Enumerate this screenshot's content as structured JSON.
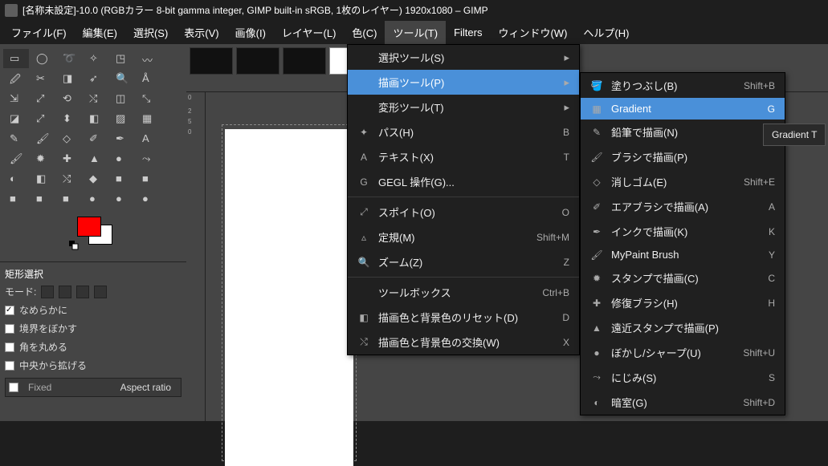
{
  "titlebar": {
    "text": "[名称未設定]-10.0 (RGBカラー 8-bit gamma integer, GIMP built-in sRGB, 1枚のレイヤー) 1920x1080 – GIMP"
  },
  "menubar": {
    "items": [
      "ファイル(F)",
      "編集(E)",
      "選択(S)",
      "表示(V)",
      "画像(I)",
      "レイヤー(L)",
      "色(C)",
      "ツール(T)",
      "Filters",
      "ウィンドウ(W)",
      "ヘルプ(H)"
    ],
    "active_index": 7
  },
  "tools_menu": {
    "items": [
      {
        "icon": "",
        "label": "選択ツール(S)",
        "shortcut": "",
        "arrow": true
      },
      {
        "icon": "",
        "label": "描画ツール(P)",
        "shortcut": "",
        "arrow": true,
        "highlight": true
      },
      {
        "icon": "",
        "label": "変形ツール(T)",
        "shortcut": "",
        "arrow": true
      },
      {
        "icon": "✦",
        "label": "パス(H)",
        "shortcut": "B"
      },
      {
        "icon": "A",
        "label": "テキスト(X)",
        "shortcut": "T"
      },
      {
        "icon": "G",
        "label": "GEGL 操作(G)...",
        "shortcut": ""
      },
      {
        "sep": true
      },
      {
        "icon": "⤢",
        "label": "スポイト(O)",
        "shortcut": "O"
      },
      {
        "icon": "▵",
        "label": "定規(M)",
        "shortcut": "Shift+M"
      },
      {
        "icon": "🔍",
        "label": "ズーム(Z)",
        "shortcut": "Z"
      },
      {
        "sep": true
      },
      {
        "icon": "",
        "label": "ツールボックス",
        "shortcut": "Ctrl+B"
      },
      {
        "icon": "◧",
        "label": "描画色と背景色のリセット(D)",
        "shortcut": "D"
      },
      {
        "icon": "⤭",
        "label": "描画色と背景色の交換(W)",
        "shortcut": "X"
      }
    ]
  },
  "paint_menu": {
    "items": [
      {
        "icon": "🪣",
        "label": "塗りつぶし(B)",
        "shortcut": "Shift+B"
      },
      {
        "icon": "▦",
        "label": "Gradient",
        "shortcut": "G",
        "highlight": true
      },
      {
        "icon": "✎",
        "label": "鉛筆で描画(N)",
        "shortcut": ""
      },
      {
        "icon": "🖌",
        "label": "ブラシで描画(P)",
        "shortcut": ""
      },
      {
        "icon": "◇",
        "label": "消しゴム(E)",
        "shortcut": "Shift+E"
      },
      {
        "icon": "✐",
        "label": "エアブラシで描画(A)",
        "shortcut": "A"
      },
      {
        "icon": "✒",
        "label": "インクで描画(K)",
        "shortcut": "K"
      },
      {
        "icon": "🖌",
        "label": "MyPaint Brush",
        "shortcut": "Y"
      },
      {
        "icon": "✹",
        "label": "スタンプで描画(C)",
        "shortcut": "C"
      },
      {
        "icon": "✚",
        "label": "修復ブラシ(H)",
        "shortcut": "H"
      },
      {
        "icon": "▲",
        "label": "遠近スタンプで描画(P)",
        "shortcut": ""
      },
      {
        "icon": "●",
        "label": "ぼかし/シャープ(U)",
        "shortcut": "Shift+U"
      },
      {
        "icon": "⤳",
        "label": "にじみ(S)",
        "shortcut": "S"
      },
      {
        "icon": "◐",
        "label": "暗室(G)",
        "shortcut": "Shift+D"
      }
    ]
  },
  "tooltip": {
    "text": "Gradient T"
  },
  "tool_options": {
    "title": "矩形選択",
    "mode_label": "モード:",
    "opts": [
      "なめらかに",
      "境界をぼかす",
      "角を丸める",
      "中央から拡げる"
    ],
    "checked_index": 0,
    "fixed_label": "Fixed",
    "aspect_label": "Aspect ratio"
  },
  "colors": {
    "fg": "#ff0000",
    "bg": "#ffffff"
  },
  "ruler_v": [
    "0",
    "",
    "2",
    "5",
    "0"
  ]
}
